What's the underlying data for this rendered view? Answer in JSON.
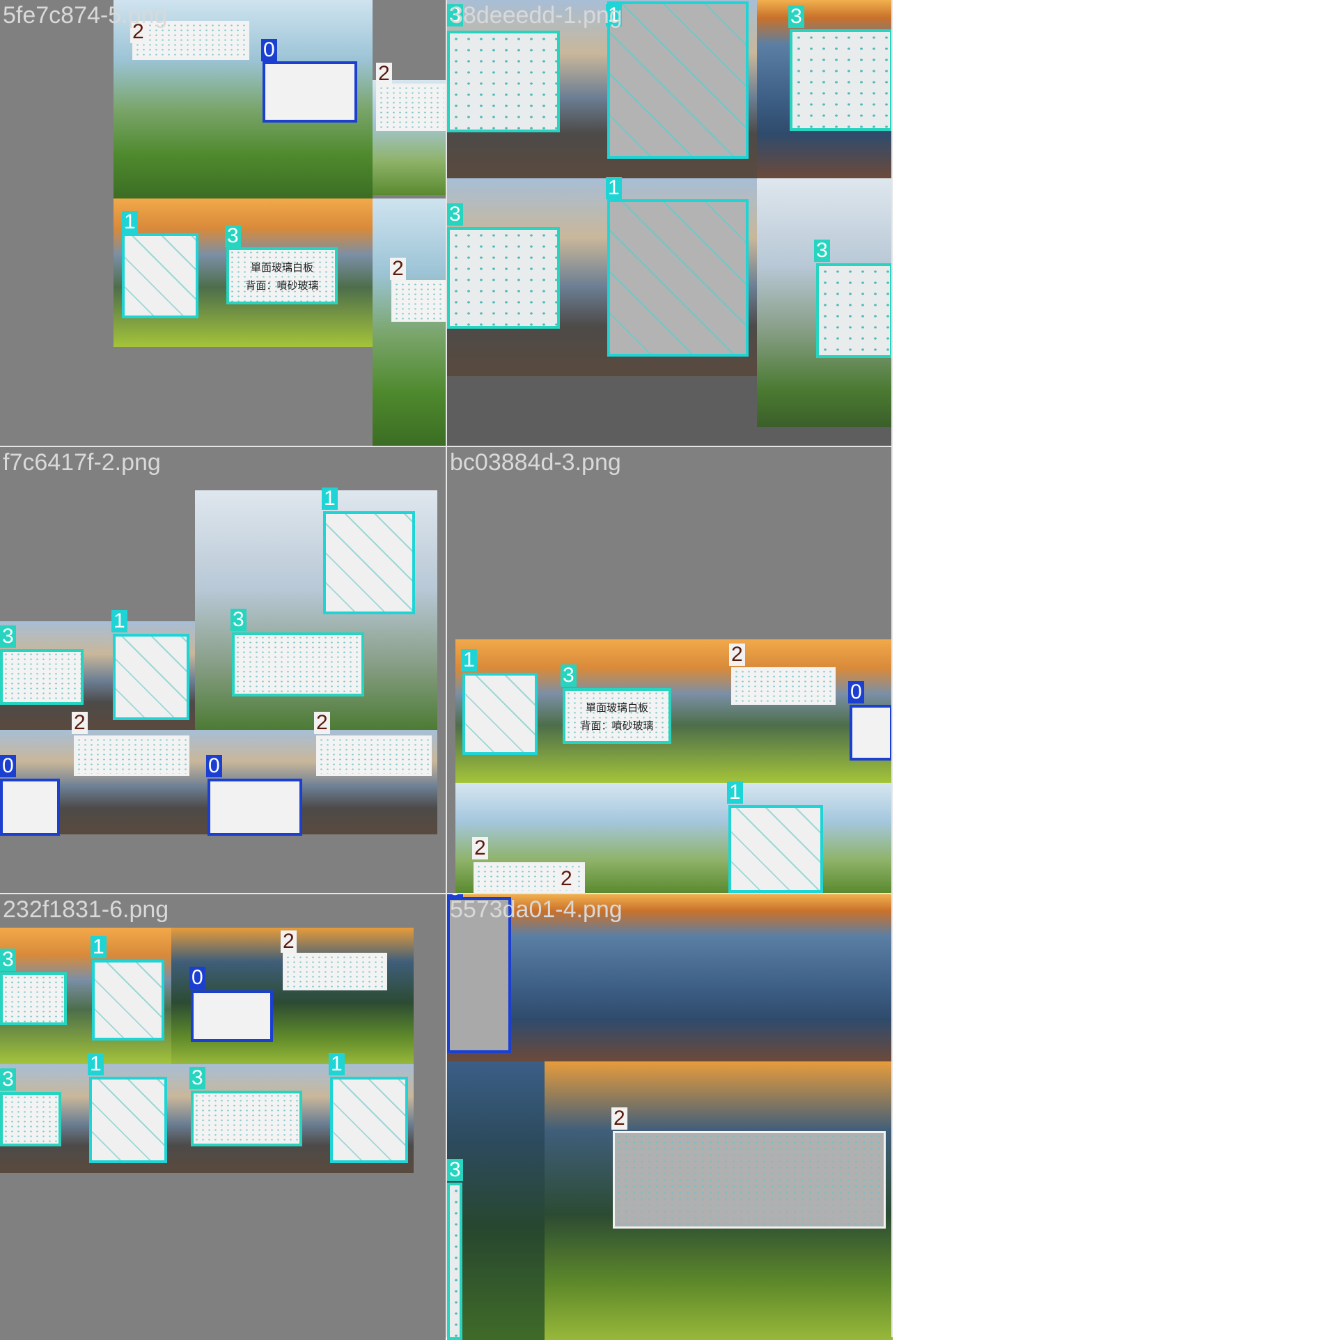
{
  "tiles": [
    {
      "filename": "5fe7c874-5.png"
    },
    {
      "filename": "38deeedd-1.png"
    },
    {
      "filename": "f7c6417f-2.png"
    },
    {
      "filename": "bc03884d-3.png"
    },
    {
      "filename": "232f1831-6.png"
    },
    {
      "filename": "5573da01-4.png"
    }
  ],
  "class_ids": {
    "c0": "0",
    "c1": "1",
    "c2": "2",
    "c3": "3"
  },
  "whiteboard_text": {
    "line1": "單面玻璃白板",
    "line2": "背面：噴砂玻璃"
  },
  "colors": {
    "class_0": "#1b3fd1",
    "class_1": "#1fd4d4",
    "class_2": "#f2f2f2",
    "class_3": "#26d4bf",
    "background": "#808080"
  }
}
